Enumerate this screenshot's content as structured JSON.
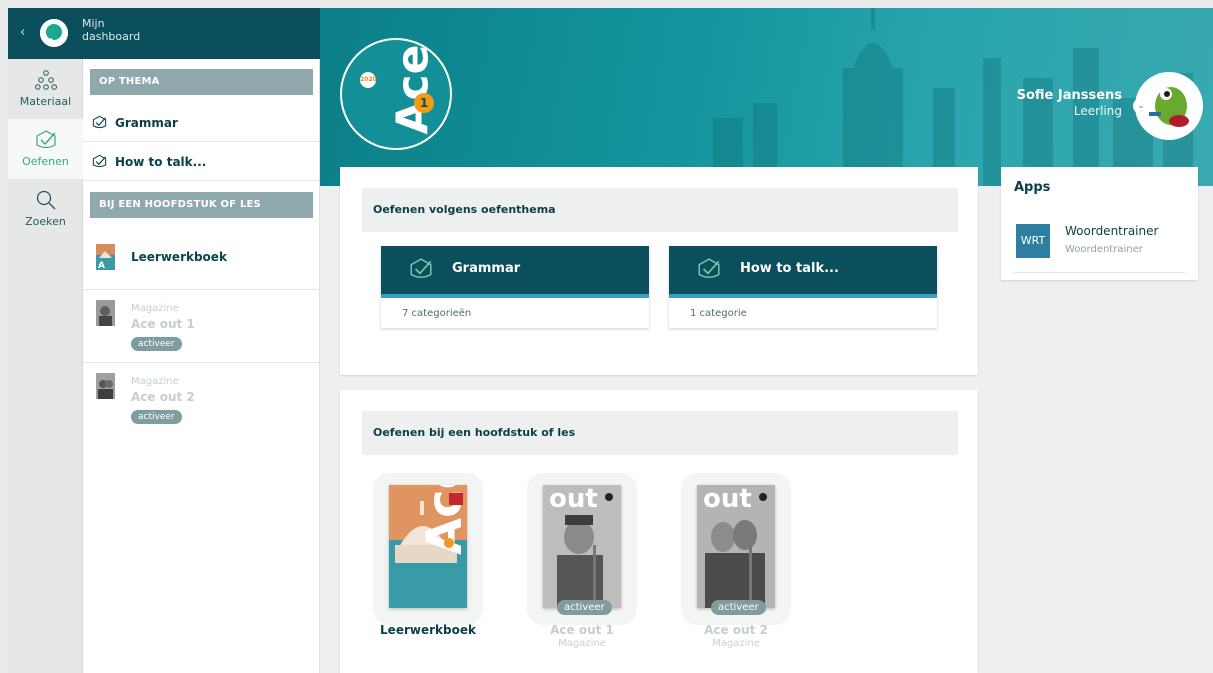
{
  "header": {
    "back_glyph": "‹",
    "title_line1": "Mijn",
    "title_line2": "dashboard"
  },
  "rail": [
    {
      "label": "Materiaal",
      "icon": "materials-icon"
    },
    {
      "label": "Oefenen",
      "icon": "check-shield-icon",
      "active": true
    },
    {
      "label": "Zoeken",
      "icon": "search-icon"
    }
  ],
  "panel": {
    "thema_head": "OP THEMA",
    "thema_items": [
      "Grammar",
      "How to talk..."
    ],
    "chapter_head": "BIJ EEN HOOFDSTUK OF LES",
    "books": [
      {
        "label": "Leerwerkboek"
      },
      {
        "kind": "Magazine",
        "label": "Ace out 1",
        "pill": "activeer"
      },
      {
        "kind": "Magazine",
        "label": "Ace out 2",
        "pill": "activeer"
      }
    ]
  },
  "hero": {
    "badge_year": "2020",
    "badge_title": "Ace",
    "badge_number": "1",
    "user_name": "Sofie Janssens",
    "user_role": "Leerling",
    "chevron": "⌄"
  },
  "practice_theme": {
    "heading": "Oefenen volgens oefenthema",
    "tiles": [
      {
        "title": "Grammar",
        "sub": "7 categorieën"
      },
      {
        "title": "How to talk...",
        "sub": "1 categorie"
      }
    ]
  },
  "practice_chapter": {
    "heading": "Oefenen bij een hoofdstuk of les",
    "covers": [
      {
        "caption": "Leerwerkboek"
      },
      {
        "caption": "Ace out 1",
        "sub": "Magazine",
        "pill": "activeer"
      },
      {
        "caption": "Ace out 2",
        "sub": "Magazine",
        "pill": "activeer"
      }
    ]
  },
  "apps": {
    "title": "Apps",
    "items": [
      {
        "code": "WRT",
        "name": "Woordentrainer",
        "sub": "Woordentrainer"
      }
    ]
  },
  "colors": {
    "primary_dark": "#0b4f5c",
    "accent_green": "#3aa584",
    "tile_stripe": "#3a9fc4",
    "hero_teal": "#13949c",
    "badge_orange": "#f39a17"
  }
}
